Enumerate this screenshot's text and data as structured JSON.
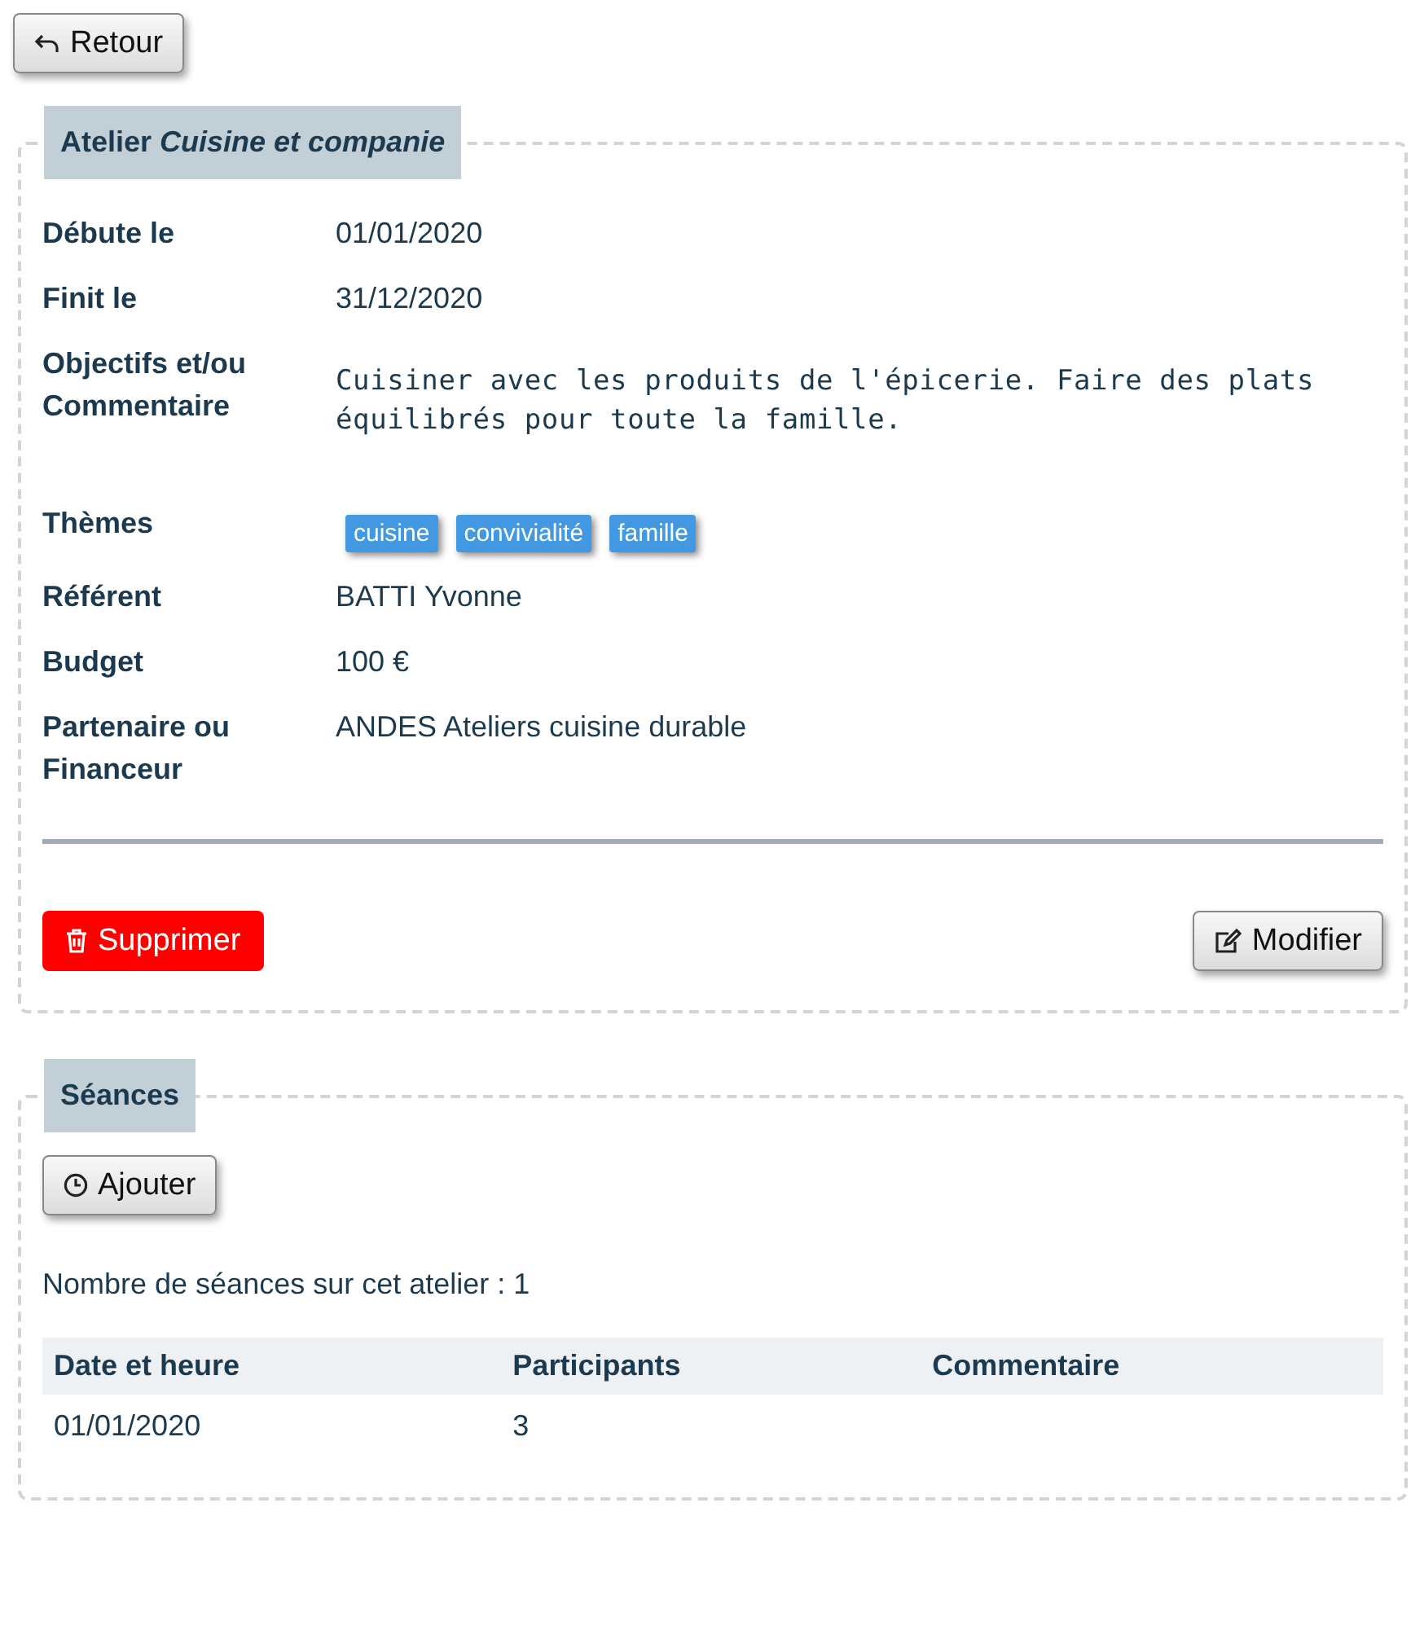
{
  "back_button": {
    "label": "Retour"
  },
  "workshop": {
    "title": "Atelier *Cuisine et companie*",
    "fields": [
      {
        "kind": "text",
        "label": "Débute le",
        "value": "01/01/2020"
      },
      {
        "kind": "text",
        "label": "Finit le",
        "value": "31/12/2020"
      },
      {
        "kind": "mono",
        "label": "Objectifs et/ou Commentaire",
        "value": "Cuisiner avec les produits de l'épicerie. Faire des plats équilibrés pour toute la famille."
      },
      {
        "kind": "tags",
        "label": "Thèmes",
        "tags": [
          "cuisine",
          "convivialité",
          "famille"
        ]
      },
      {
        "kind": "text",
        "label": "Référent",
        "value": "BATTI Yvonne"
      },
      {
        "kind": "text",
        "label": "Budget",
        "value": "100 €"
      },
      {
        "kind": "text",
        "label": "Partenaire ou Financeur",
        "value": "ANDES Ateliers cuisine durable"
      }
    ],
    "delete_button": {
      "label": "Supprimer"
    },
    "edit_button": {
      "label": "Modifier"
    }
  },
  "sessions": {
    "title": "Séances",
    "add_button": {
      "label": "Ajouter"
    },
    "count_text": "Nombre de séances sur cet atelier : 1",
    "table": {
      "columns": [
        "Date et heure",
        "Participants",
        "Commentaire"
      ],
      "rows": [
        [
          "01/01/2020",
          "3",
          ""
        ]
      ]
    }
  }
}
